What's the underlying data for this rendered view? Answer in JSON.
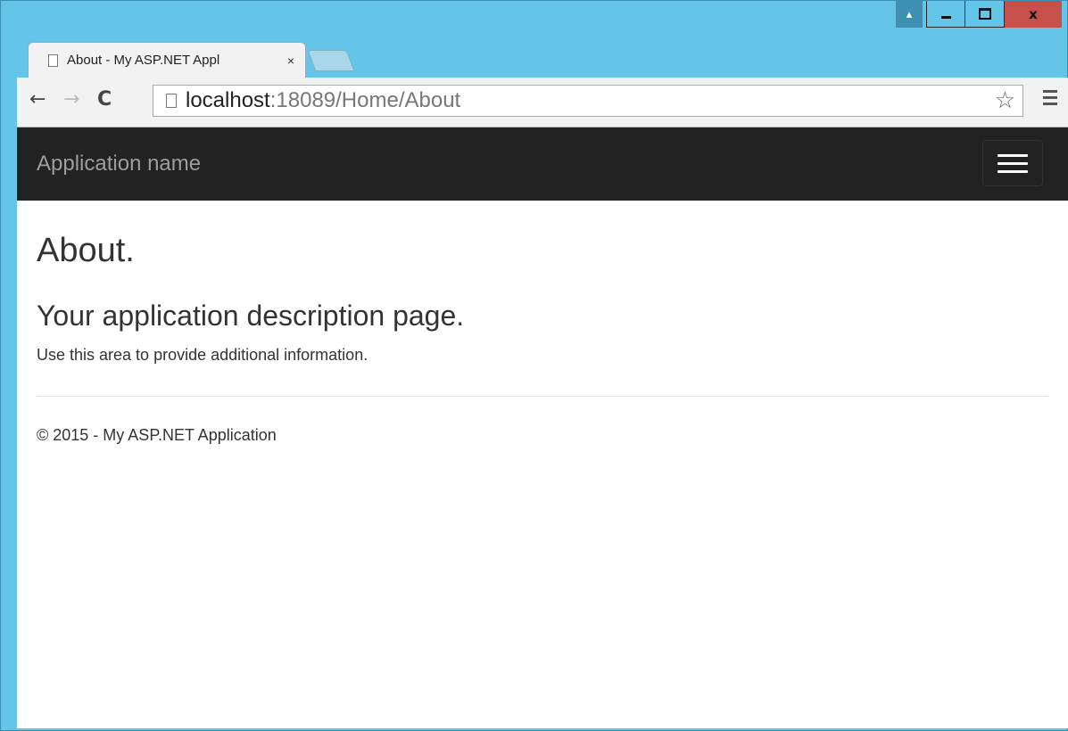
{
  "window": {
    "controls": {
      "user_icon": "person-icon",
      "minimize": "minimize-icon",
      "maximize": "maximize-icon",
      "close": "x"
    }
  },
  "tabs": [
    {
      "title": "About - My ASP.NET Appl",
      "close": "×"
    }
  ],
  "toolbar": {
    "url_host": "localhost",
    "url_path": ":18089/Home/About"
  },
  "navbar": {
    "brand": "Application name"
  },
  "main": {
    "title": "About.",
    "subtitle": "Your application description page.",
    "body": "Use this area to provide additional information."
  },
  "footer": {
    "text": "© 2015 - My ASP.NET Application"
  },
  "colors": {
    "navbar_bg": "#222222",
    "brand_text": "#9d9d9d",
    "window_frame": "#65c5e8",
    "close_button": "#c7504a"
  }
}
